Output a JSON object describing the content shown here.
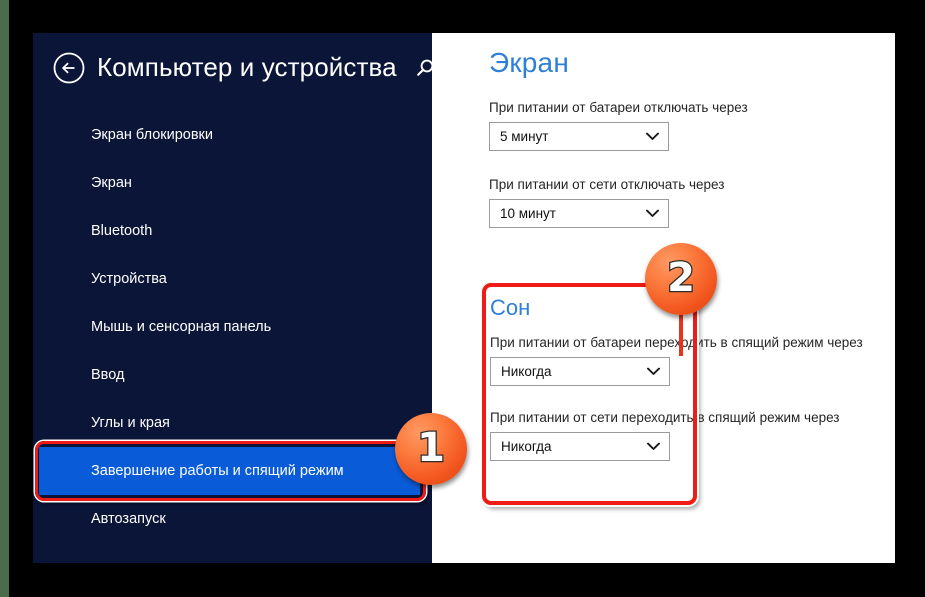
{
  "window": {
    "os": "Windows 8.1 PC Settings"
  },
  "sidebar": {
    "back_label": "back-arrow",
    "title": "Компьютер и устройства",
    "search_label": "search",
    "items": [
      {
        "label": "Экран блокировки",
        "selected": false
      },
      {
        "label": "Экран",
        "selected": false
      },
      {
        "label": "Bluetooth",
        "selected": false
      },
      {
        "label": "Устройства",
        "selected": false
      },
      {
        "label": "Мышь и сенсорная панель",
        "selected": false
      },
      {
        "label": "Ввод",
        "selected": false
      },
      {
        "label": "Углы и края",
        "selected": false
      },
      {
        "label": "Завершение работы и спящий режим",
        "selected": true
      },
      {
        "label": "Автозапуск",
        "selected": false
      }
    ]
  },
  "content": {
    "title": "Экран",
    "fields": [
      {
        "label": "При питании от батареи отключать через",
        "value": "5 минут"
      },
      {
        "label": "При питании от сети отключать через",
        "value": "10 минут"
      }
    ],
    "sleep_section": {
      "title": "Сон",
      "fields": [
        {
          "label": "При питании от батареи переходить в спящий режим через",
          "value": "Никогда"
        },
        {
          "label": "При питании от сети переходить в спящий режим через",
          "value": "Никогда"
        }
      ]
    }
  },
  "annotations": {
    "badges": [
      {
        "number": "1"
      },
      {
        "number": "2"
      }
    ],
    "highlight_color": "#ee1b16",
    "badge_color": "#f45a22"
  },
  "colors": {
    "sidebar_bg": "#0b1538",
    "selected_bg": "#0a5bd8",
    "accent_blue": "#2f7fd6",
    "content_bg": "#ffffff",
    "frame_black": "#000000",
    "edge_green": "#4a6b4c"
  }
}
